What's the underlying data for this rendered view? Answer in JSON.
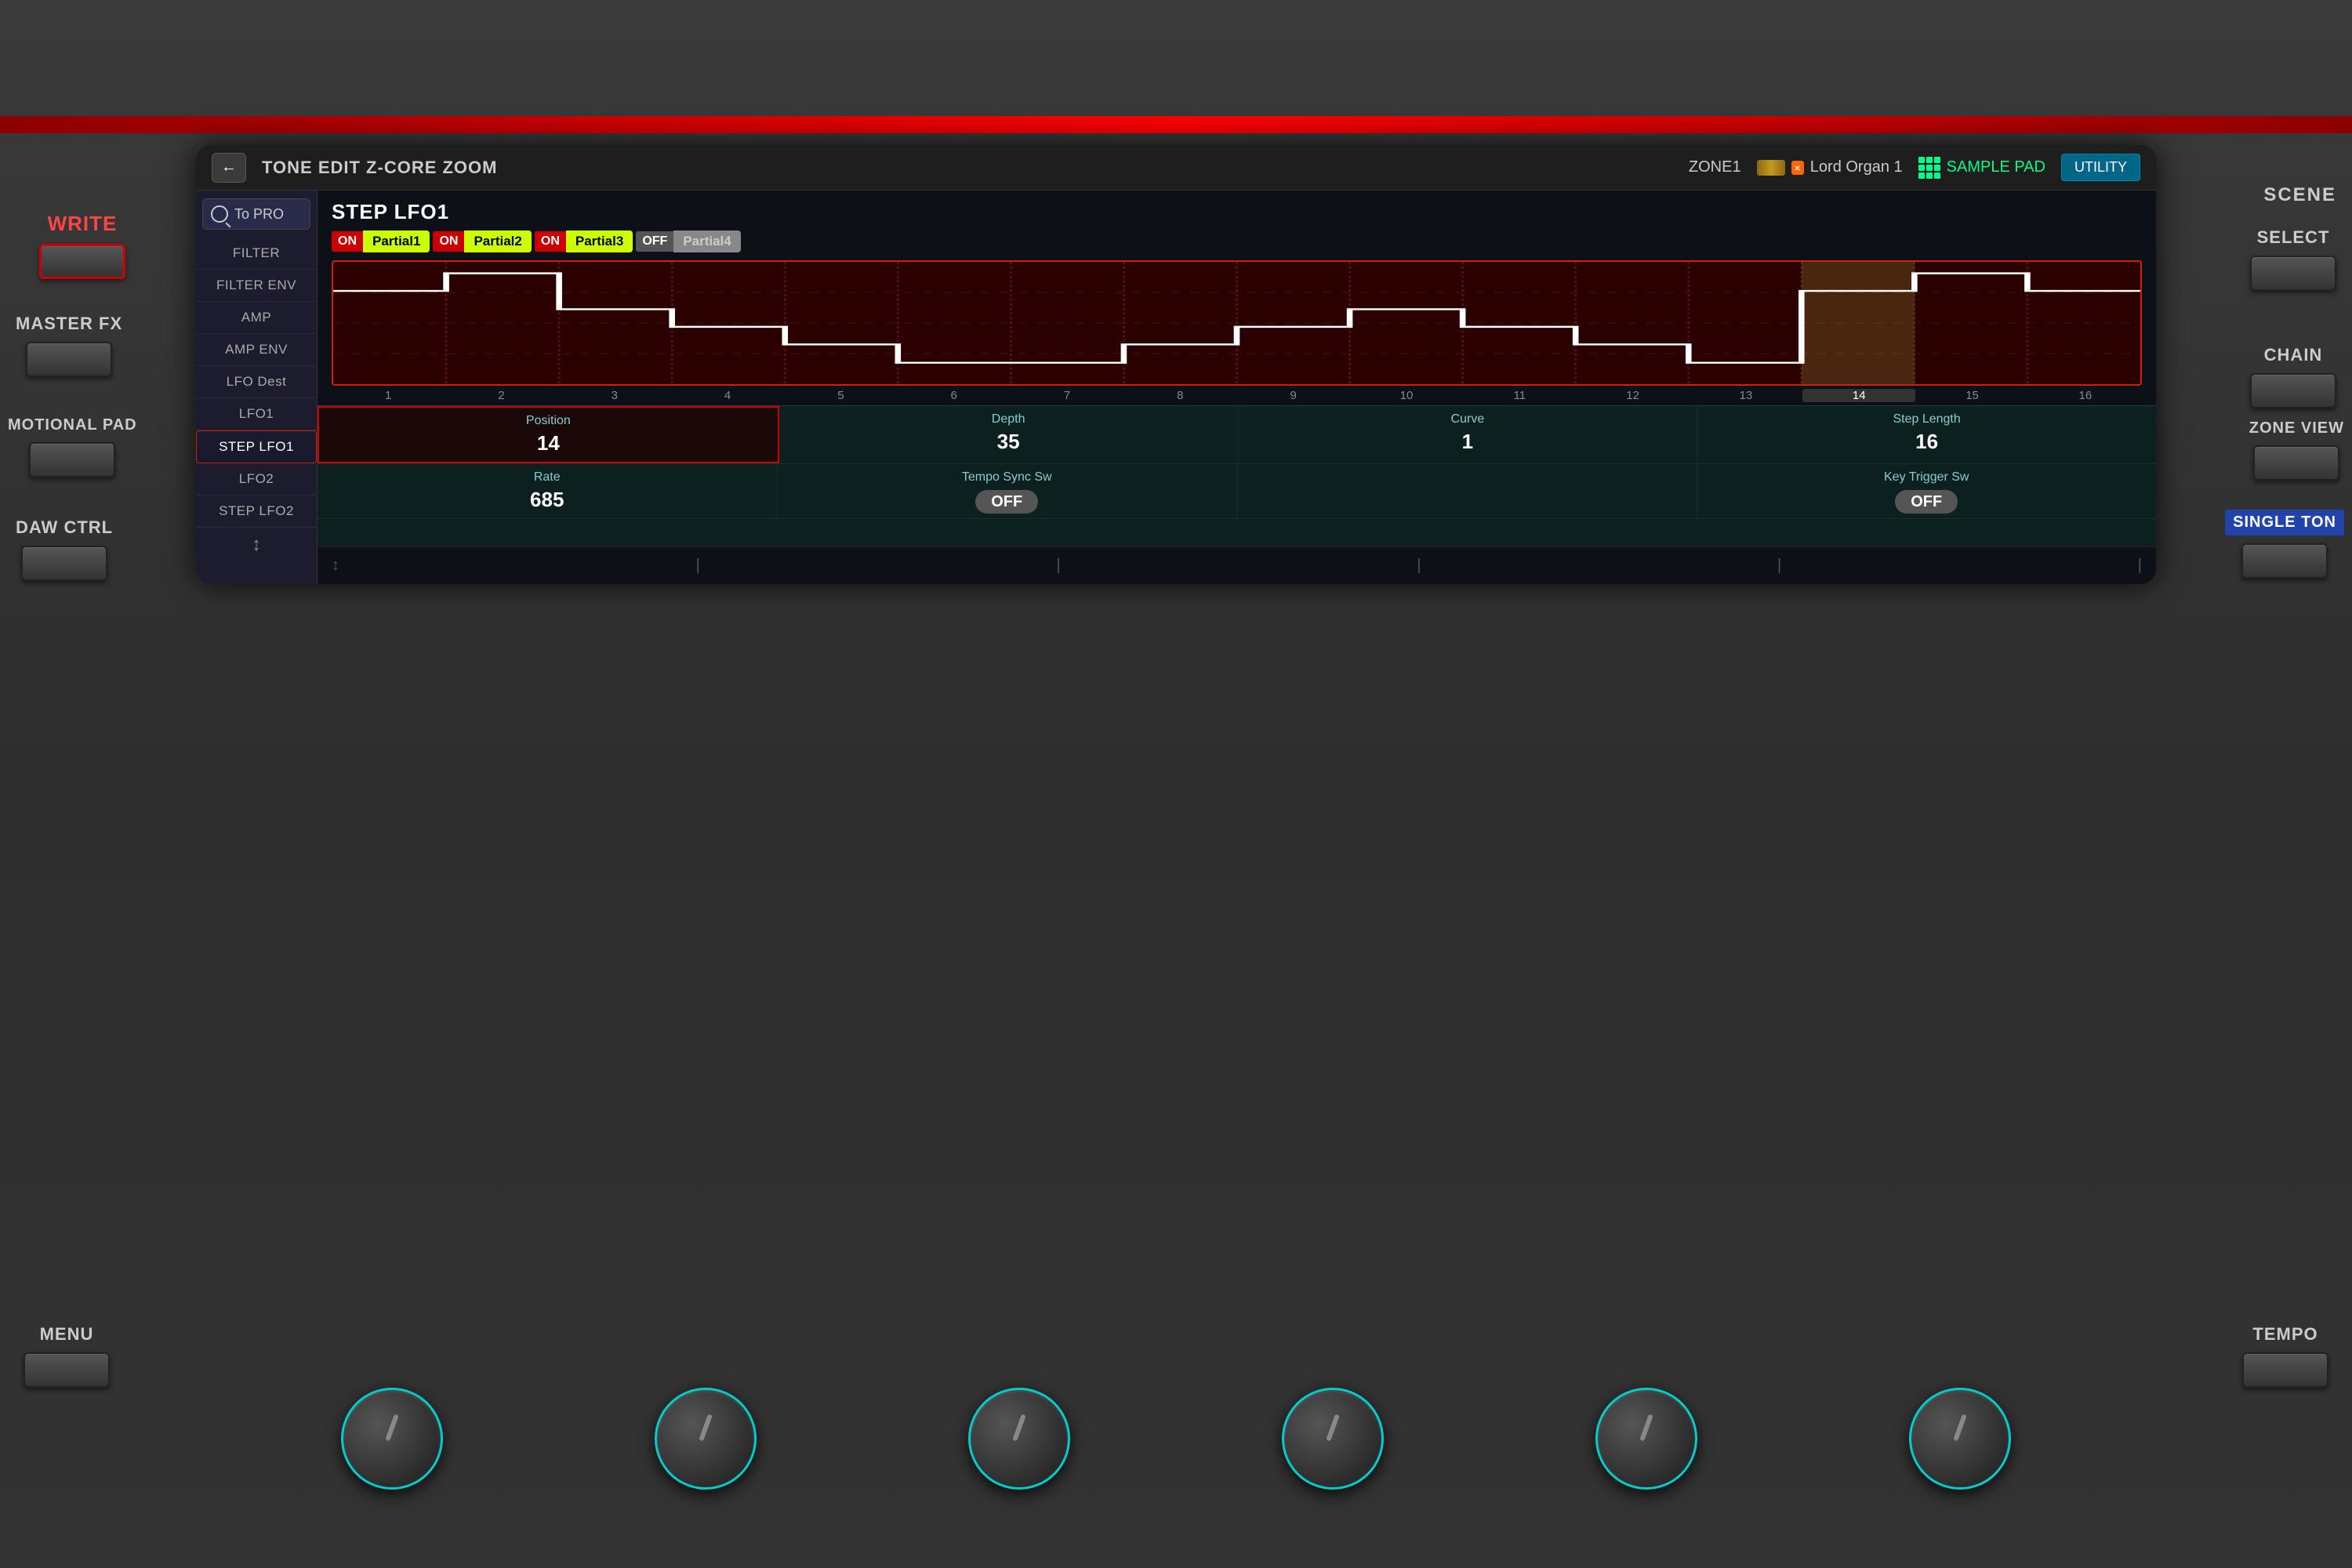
{
  "hardware": {
    "red_line_top": "red accent stripe",
    "write_label": "WRITE",
    "master_fx_label": "MASTER FX",
    "motional_pad_label": "MOTIONAL PAD",
    "daw_ctrl_label": "DAW CTRL",
    "menu_label": "MENU",
    "scene_label": "SCENE",
    "select_label": "SELECT",
    "chain_label": "CHAIN",
    "zone_view_label": "ZONE VIEW",
    "single_ton_label": "SINGLE TON",
    "tempo_label": "TEMPO"
  },
  "screen": {
    "header": {
      "back_arrow": "←",
      "title": "TONE EDIT Z-CORE ZOOM",
      "zone": "ZONE1",
      "instrument_name": "Lord Organ 1",
      "instrument_badge": "×",
      "sample_pad_label": "SAMPLE PAD",
      "utility_label": "UTILITY"
    },
    "panel_title": "STEP LFO1",
    "partial_tabs": [
      {
        "on_label": "ON",
        "name": "Partial1",
        "active": true
      },
      {
        "on_label": "ON",
        "name": "Partial2",
        "active": false
      },
      {
        "on_label": "ON",
        "name": "Partial3",
        "active": false
      },
      {
        "on_label": "OFF",
        "name": "Partial4",
        "active": false
      }
    ],
    "step_numbers": [
      1,
      2,
      3,
      4,
      5,
      6,
      7,
      8,
      9,
      10,
      11,
      12,
      13,
      14,
      15,
      16
    ],
    "active_step": 14,
    "step_values": [
      3,
      4,
      2,
      1,
      0,
      -1,
      -1,
      0,
      1,
      2,
      1,
      0,
      -1,
      3,
      4,
      3
    ],
    "params": {
      "row1": [
        {
          "label": "Position",
          "value": "14",
          "highlighted": true
        },
        {
          "label": "Depth",
          "value": "35"
        },
        {
          "label": "Curve",
          "value": "1"
        },
        {
          "label": "Step Length",
          "value": "16"
        }
      ],
      "row2": [
        {
          "label": "Rate",
          "value": "685"
        },
        {
          "label": "Tempo Sync Sw",
          "value": "OFF",
          "is_off": true
        },
        {
          "label": "",
          "value": ""
        },
        {
          "label": "Key Trigger Sw",
          "value": "OFF",
          "is_off": true
        }
      ]
    }
  },
  "sidebar": {
    "to_pro_label": "To PRO",
    "items": [
      {
        "label": "FILTER",
        "active": false
      },
      {
        "label": "FILTER ENV",
        "active": false
      },
      {
        "label": "AMP",
        "active": false
      },
      {
        "label": "AMP ENV",
        "active": false
      },
      {
        "label": "LFO Dest",
        "active": false
      },
      {
        "label": "LFO1",
        "active": false
      },
      {
        "label": "STEP LFO1",
        "active": true
      },
      {
        "label": "LFO2",
        "active": false
      },
      {
        "label": "STEP LFO2",
        "active": false
      }
    ],
    "scroll_icon": "↕"
  }
}
